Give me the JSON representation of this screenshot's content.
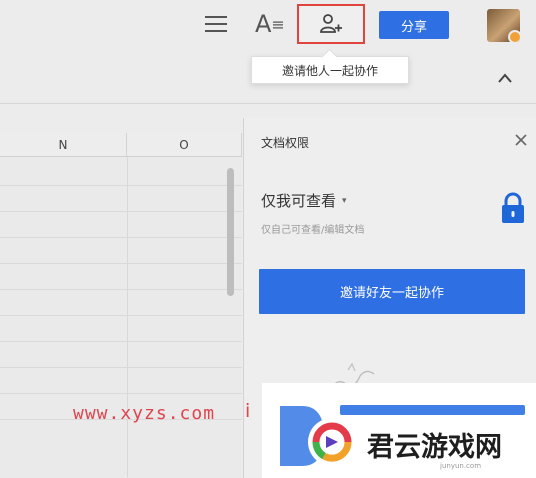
{
  "toolbar": {
    "font_glyph": "A",
    "share_label": "分享",
    "tooltip": "邀请他人一起协作"
  },
  "sheet": {
    "columns": [
      "N",
      "O"
    ]
  },
  "panel": {
    "title": "文档权限",
    "permission_label": "仅我可查看",
    "permission_caret": "▾",
    "permission_desc": "仅自己可查看/编辑文档",
    "invite_button": "邀请好友一起协作"
  },
  "watermark": {
    "url": "www.xyzs.com",
    "url_tail": "i",
    "logo_text": "君云游戏网",
    "logo_sub": "junyun.com"
  },
  "colors": {
    "accent": "#2f6fe4",
    "highlight": "#e0443e",
    "watermark": "#e0444c"
  }
}
